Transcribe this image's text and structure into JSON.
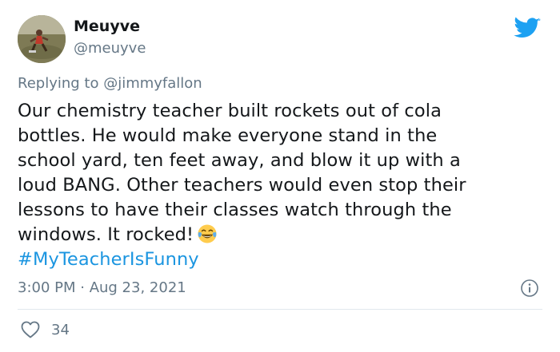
{
  "author": {
    "display_name": "Meuyve",
    "handle": "@meuyve"
  },
  "reply": {
    "prefix": "Replying to ",
    "mention": "@jimmyfallon"
  },
  "tweet": {
    "lines": [
      "Our chemistry teacher built rockets out of cola",
      "bottles. He would make everyone stand in the",
      "school yard, ten feet away, and blow it up with a",
      "loud BANG. Other teachers would even stop their",
      "lessons to have their classes watch through the",
      "windows. It rocked!"
    ],
    "emoji": "face-with-tears-of-joy-icon",
    "hashtag": "#MyTeacherIsFunny"
  },
  "meta": {
    "time": "3:00 PM · Aug 23, 2021",
    "like_count": "34"
  },
  "icons": {
    "brand": "twitter-bird-icon",
    "info": "info-icon",
    "like": "heart-icon"
  },
  "colors": {
    "brand_blue": "#1da1f2",
    "link_blue": "#1b95e0",
    "secondary_text": "#657786",
    "divider": "#e1e8ed"
  }
}
